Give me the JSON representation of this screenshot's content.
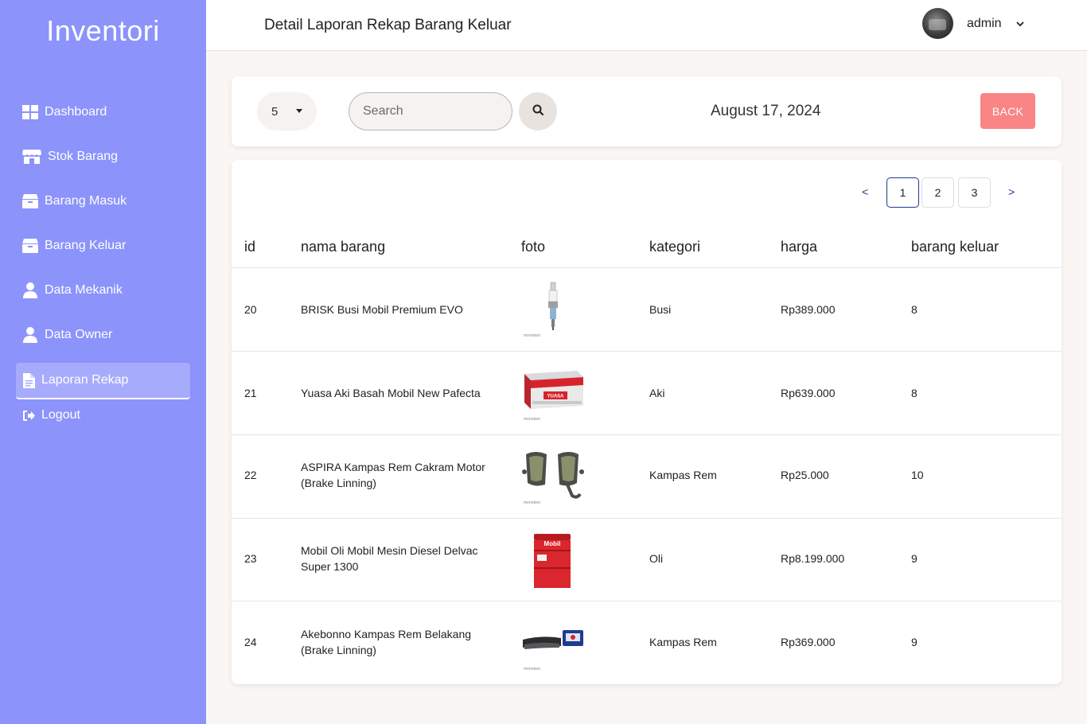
{
  "sidebar": {
    "brand": "Inventori",
    "items": [
      {
        "label": "Dashboard",
        "icon": "dashboard-icon"
      },
      {
        "label": "Stok Barang",
        "icon": "store-icon"
      },
      {
        "label": "Barang Masuk",
        "icon": "box-icon"
      },
      {
        "label": "Barang Keluar",
        "icon": "box-icon"
      },
      {
        "label": "Data Mekanik",
        "icon": "user-icon"
      },
      {
        "label": "Data Owner",
        "icon": "user-icon"
      },
      {
        "label": "Laporan Rekap",
        "icon": "file-icon",
        "active": true
      },
      {
        "label": "Logout",
        "icon": "logout-icon"
      }
    ],
    "bg_color": "#8c93fb"
  },
  "header": {
    "title": "Detail Laporan Rekap Barang Keluar",
    "user_name": "admin"
  },
  "filter": {
    "per_page": "5",
    "search_placeholder": "Search",
    "date": "August 17, 2024",
    "back_label": "BACK",
    "back_color": "#f98585"
  },
  "pagination": {
    "prev": "<",
    "next": ">",
    "pages": [
      "1",
      "2",
      "3"
    ],
    "current": "1"
  },
  "table": {
    "columns": [
      "id",
      "nama barang",
      "foto",
      "kategori",
      "harga",
      "barang keluar"
    ],
    "rows": [
      {
        "id": "20",
        "name_l1": "BRISK Busi Mobil Premium EVO",
        "name_l2": "",
        "foto": "spark-plug-image",
        "kategori": "Busi",
        "harga": "Rp389.000",
        "keluar": "8"
      },
      {
        "id": "21",
        "name_l1": "Yuasa Aki Basah Mobil New Pafecta",
        "name_l2": "",
        "foto": "car-battery-image",
        "kategori": "Aki",
        "harga": "Rp639.000",
        "keluar": "8"
      },
      {
        "id": "22",
        "name_l1": "ASPIRA Kampas Rem Cakram Motor",
        "name_l2": "(Brake Linning)",
        "foto": "brake-pads-image",
        "kategori": "Kampas Rem",
        "harga": "Rp25.000",
        "keluar": "10"
      },
      {
        "id": "23",
        "name_l1": "Mobil Oli Mobil Mesin Diesel Delvac",
        "name_l2": "Super 1300",
        "foto": "oil-drum-image",
        "kategori": "Oli",
        "harga": "Rp8.199.000",
        "keluar": "9"
      },
      {
        "id": "24",
        "name_l1": "Akebonno Kampas Rem Belakang",
        "name_l2": "(Brake Linning)",
        "foto": "brake-shoe-image",
        "kategori": "Kampas Rem",
        "harga": "Rp369.000",
        "keluar": "9"
      }
    ],
    "image_labels": {
      "battery": "YUASA",
      "drum": "Mobil",
      "watermark": "monotaro"
    }
  }
}
